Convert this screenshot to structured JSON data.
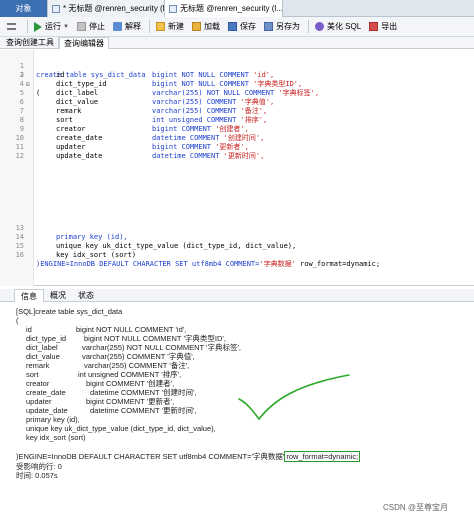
{
  "tabs": {
    "objects": "对象",
    "tab1": "* 无标题 @renren_security (l...",
    "tab2": "无标题 @renren_security (l...",
    "close": "×"
  },
  "toolbar": {
    "run": "运行",
    "stop": "停止",
    "explain": "解释",
    "new": "新建",
    "load": "加载",
    "save": "保存",
    "saveas": "另存为",
    "beautify": "美化 SQL",
    "export": "导出"
  },
  "subtabs": [
    "查询创建工具",
    "查询编辑器"
  ],
  "editor": {
    "line_numbers": [
      "1",
      "2",
      "3",
      "4",
      "5",
      "6",
      "7",
      "8",
      "9",
      "10",
      "11",
      "12",
      "13",
      "14",
      "15",
      "16"
    ],
    "l1": "create table sys_dict_data",
    "l2": "(",
    "rows": [
      {
        "name": "id",
        "type": "bigint NOT NULL COMMENT ",
        "comment": "'id',"
      },
      {
        "name": "dict_type_id",
        "type": "bigint NOT NULL COMMENT ",
        "comment": "'字典类型ID',"
      },
      {
        "name": "dict_label",
        "type": "varchar(255) NOT NULL COMMENT ",
        "comment": "'字典标签',"
      },
      {
        "name": "dict_value",
        "type": "varchar(255) COMMENT ",
        "comment": "'字典值',"
      },
      {
        "name": "remark",
        "type": "varchar(255) COMMENT ",
        "comment": "'备注',"
      },
      {
        "name": "sort",
        "type": "int unsigned COMMENT ",
        "comment": "'排序',"
      },
      {
        "name": "creator",
        "type": "bigint COMMENT ",
        "comment": "'创建者',"
      },
      {
        "name": "create_date",
        "type": "datetime COMMENT ",
        "comment": "'创建时间',"
      },
      {
        "name": "updater",
        "type": "bigint COMMENT ",
        "comment": "'更新者',"
      },
      {
        "name": "update_date",
        "type": "datetime COMMENT ",
        "comment": "'更新时间',"
      }
    ],
    "l13": "primary key (id),",
    "l14": "unique key uk_dict_type_value (dict_type_id, dict_value),",
    "l15": "key idx_sort (sort)",
    "l16_a": ")ENGINE=InnoDB DEFAULT CHARACTER SET utf8mb4 COMMENT=",
    "l16_b": "'字典数据'",
    "l16_c": " row_format=dynamic;"
  },
  "bottom_tabs": [
    "信息",
    "概况",
    "状态"
  ],
  "output": {
    "l0": "[SQL]create table sys_dict_data",
    "l1": "(",
    "rows": [
      {
        "name": "id",
        "type": "bigint NOT NULL COMMENT 'id',"
      },
      {
        "name": "dict_type_id",
        "type": "bigint NOT NULL COMMENT '字典类型ID',"
      },
      {
        "name": "dict_label",
        "type": "varchar(255) NOT NULL COMMENT '字典标签',"
      },
      {
        "name": "dict_value",
        "type": "varchar(255) COMMENT '字典值',"
      },
      {
        "name": "remark",
        "type": "varchar(255) COMMENT '备注',"
      },
      {
        "name": "sort",
        "type": "int unsigned COMMENT '排序',"
      },
      {
        "name": "creator",
        "type": "bigint COMMENT '创建者',"
      },
      {
        "name": "create_date",
        "type": "datetime COMMENT '创建时间',"
      },
      {
        "name": "updater",
        "type": "bigint COMMENT '更新者',"
      },
      {
        "name": "update_date",
        "type": "datetime COMMENT '更新时间',"
      }
    ],
    "pk": "primary key (id),",
    "uk": "unique key uk_dict_type_value (dict_type_id, dict_value),",
    "idx": "key idx_sort (sort)",
    "engine": ")ENGINE=InnoDB DEFAULT CHARACTER SET utf8mb4 COMMENT='字典数据'",
    "rowfmt": "row_format=dynamic;",
    "affected": "受影响的行: 0",
    "time": "时间: 0.057s"
  },
  "watermark": "CSDN @至尊宝月",
  "colors": {
    "keyword": "#1d3fd0",
    "string": "#c81e1e",
    "highlight_box": "#2a9a2a",
    "checkmark": "#2aa82a"
  }
}
